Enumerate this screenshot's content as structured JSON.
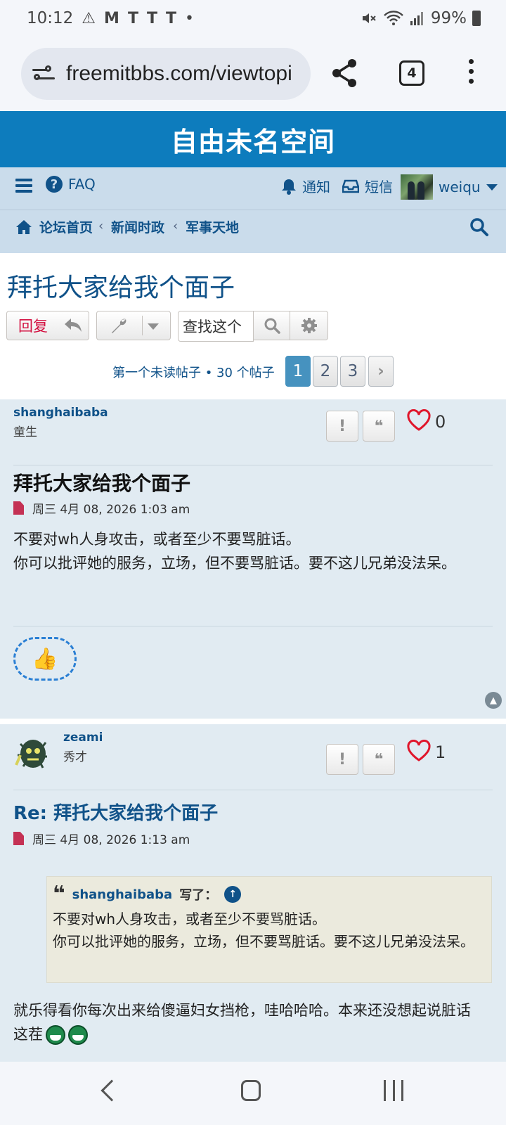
{
  "status_bar": {
    "time": "10:12",
    "notif_icons": [
      "⚠",
      "M",
      "T",
      "T",
      "T",
      "•"
    ],
    "battery": "99%"
  },
  "browser": {
    "url": "freemitbbs.com/viewtopi",
    "tab_count": "4"
  },
  "site": {
    "title": "自由未名空间",
    "nav": {
      "faq": "FAQ",
      "notifications": "通知",
      "messages": "短信",
      "username": "weiqu"
    },
    "breadcrumbs": [
      "论坛首页",
      "新闻时政",
      "军事天地"
    ]
  },
  "topic": {
    "title": "拜托大家给我个面子",
    "reply_label": "回复",
    "search_placeholder": "查找这个",
    "pagination_info": "第一个未读帖子 • 30 个帖子",
    "pages": [
      "1",
      "2",
      "3"
    ],
    "current_page": "1"
  },
  "posts": [
    {
      "author": "shanghaibaba",
      "rank": "童生",
      "likes": "0",
      "title": "拜托大家给我个面子",
      "date": "周三 4月 08, 2026 1:03 am",
      "body_lines": [
        "不要对wh人身攻击，或者至少不要骂脏话。",
        "你可以批评她的服务，立场，但不要骂脏话。要不这儿兄弟没法呆。"
      ],
      "reaction": "👍"
    },
    {
      "author": "zeami",
      "rank": "秀才",
      "likes": "1",
      "title": "Re: 拜托大家给我个面子",
      "date": "周三 4月 08, 2026 1:13 am",
      "quote": {
        "author": "shanghaibaba",
        "wrote": "写了：",
        "lines": [
          "不要对wh人身攻击，或者至少不要骂脏话。",
          "你可以批评她的服务，立场，但不要骂脏话。要不这儿兄弟没法呆。"
        ]
      },
      "body": "就乐得看你每次出来给傻逼妇女挡枪，哇哈哈哈。本来还没想起说脏话这茬"
    }
  ],
  "colors": {
    "brand": "#0d7cbd",
    "navbar": "#cadceb",
    "link": "#105289",
    "post_bg": "#e1ebf2",
    "reply": "#d31141",
    "like": "#e0162b"
  }
}
